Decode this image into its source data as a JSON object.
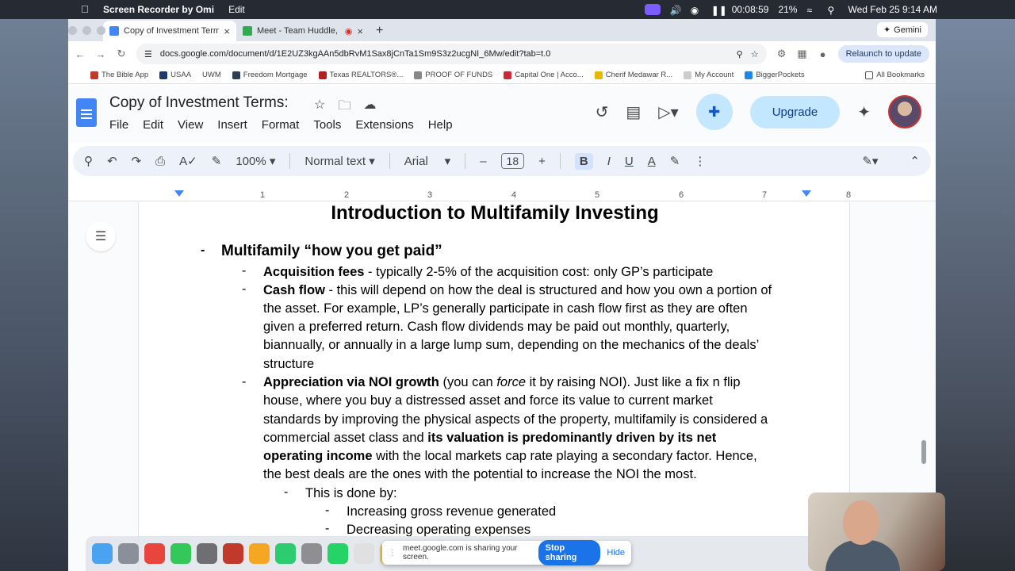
{
  "menubar": {
    "app_name": "Screen Recorder by Omi",
    "menu_edit": "Edit",
    "timer": "00:08:59",
    "battery": "21%",
    "datetime": "Wed Feb 25  9:14 AM"
  },
  "browser": {
    "tabs": [
      {
        "label": "Copy of Investment Terms: -",
        "color": "#4285f4"
      },
      {
        "label": "Meet - Team Huddle, pro",
        "color": "#34a853"
      }
    ],
    "gemini": "Gemini",
    "url": "docs.google.com/document/d/1E2UZ3kgAAn5dbRvM1Sax8jCnTa1Sm9S3z2ucgNI_6Mw/edit?tab=t.0",
    "relaunch": "Relaunch to update",
    "bookmarks": [
      "The Bible App",
      "USAA",
      "UWM",
      "Freedom Mortgage",
      "Texas REALTORS®...",
      "PROOF OF FUNDS",
      "Capital One | Acco...",
      "Cherif Medawar R...",
      "My Account",
      "BiggerPockets"
    ],
    "all_bookmarks": "All Bookmarks"
  },
  "docs": {
    "title": "Copy of Investment Terms:",
    "menu": [
      "File",
      "Edit",
      "View",
      "Insert",
      "Format",
      "Tools",
      "Extensions",
      "Help"
    ],
    "upgrade": "Upgrade",
    "toolbar": {
      "zoom": "100%",
      "style": "Normal text",
      "font": "Arial",
      "font_size": "18"
    },
    "ruler": [
      "1",
      "2",
      "3",
      "4",
      "5",
      "6",
      "7",
      "8"
    ]
  },
  "document": {
    "heading": "Introduction to Multifamily Investing",
    "bullet1": "Multifamily “how you get paid”",
    "acq_bold": "Acquisition fees",
    "acq_text": " - typically 2-5% of the acquisition cost: only GP’s participate",
    "cf_bold": "Cash flow",
    "cf_l1": " - this will depend on how the deal is structured and how you own a portion of",
    "cf_l2": "the asset. For example, LP’s generally participate in cash flow first as they are often",
    "cf_l3": "given a preferred return. Cash flow dividends may be paid out monthly, quarterly,",
    "cf_l4": "biannually, or annually in a large lump sum, depending on the mechanics of the deals’",
    "cf_l5": "structure",
    "ap_bold": "Appreciation via NOI growth",
    "ap_l1a": " (you can ",
    "ap_l1b": "force",
    "ap_l1c": " it by raising NOI). Just like a fix n flip",
    "ap_l2": "house, where you buy a distressed asset and force its value to current market",
    "ap_l3": "standards by improving the physical aspects of the property, multifamily is considered a",
    "ap_l4a": "commercial asset class and ",
    "ap_l4b": "its valuation is predominantly driven by its net",
    "ap_l5a": "operating income",
    "ap_l5b": " with the local markets cap rate playing a secondary factor. Hence,",
    "ap_l6": "the best deals are the ones with the potential to increase the NOI the most.",
    "done_by": "This is done by:",
    "sub1": "Increasing gross revenue generated",
    "sub2": "Decreasing operating expenses"
  },
  "sharebar": {
    "text": "meet.google.com is sharing your screen.",
    "stop": "Stop sharing",
    "hide": "Hide"
  }
}
